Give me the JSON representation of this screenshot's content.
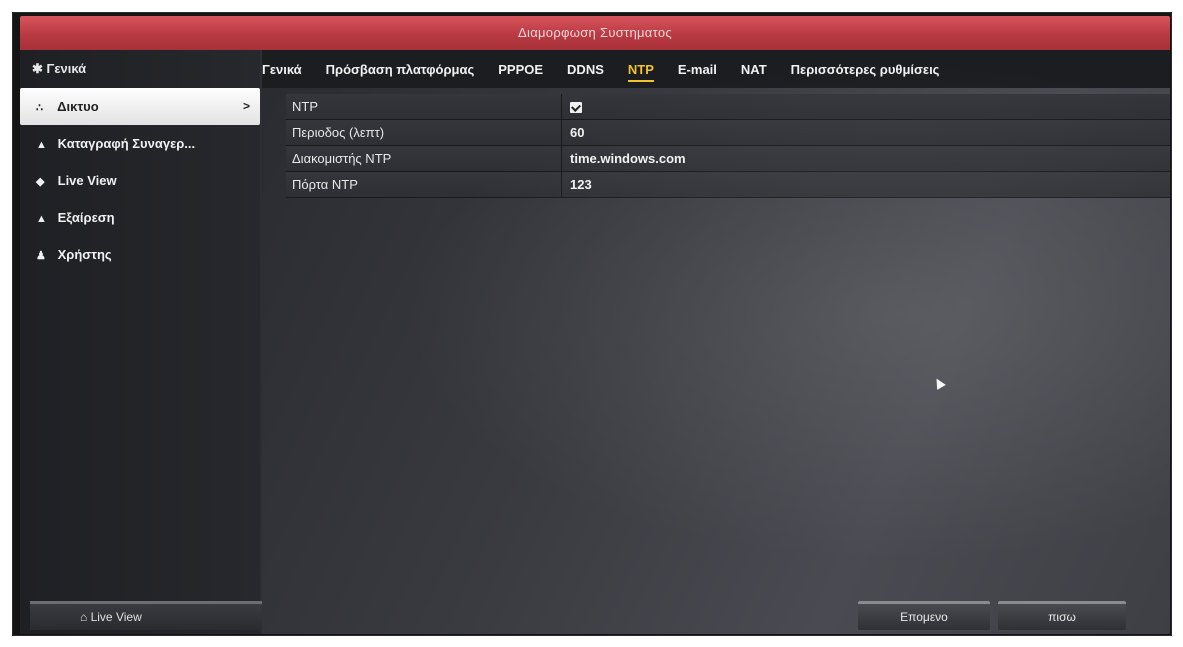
{
  "window": {
    "title": "Διαμορφωση Συστηματος"
  },
  "sidebar": {
    "header": {
      "icon": "gear-icon",
      "label": "Γενικά"
    },
    "items": [
      {
        "icon": "network-icon",
        "label": "Δικτυο",
        "active": true,
        "arrow": ">"
      },
      {
        "icon": "alarm-icon",
        "label": "Καταγραφή Συναγερ..."
      },
      {
        "icon": "eye-icon",
        "label": "Live View"
      },
      {
        "icon": "warning-icon",
        "label": "Εξαίρεση"
      },
      {
        "icon": "user-icon",
        "label": "Χρήστης"
      }
    ],
    "footer": {
      "icon": "home-icon",
      "label": "Live View"
    }
  },
  "tabs": [
    {
      "label": "Γενικά"
    },
    {
      "label": "Πρόσβαση πλατφόρμας"
    },
    {
      "label": "PPPOE"
    },
    {
      "label": "DDNS"
    },
    {
      "label": "NTP",
      "active": true
    },
    {
      "label": "E-mail"
    },
    {
      "label": "NAT"
    },
    {
      "label": "Περισσότερες ρυθμίσεις"
    }
  ],
  "ntp": {
    "rows": [
      {
        "label": "NTP",
        "checked": true
      },
      {
        "label": "Περιοδος (λεπτ)",
        "value": "60"
      },
      {
        "label": "Διακομιστής NTP",
        "value": "time.windows.com"
      },
      {
        "label": "Πόρτα NTP",
        "value": "123"
      }
    ]
  },
  "buttons": {
    "next": "Επομενο",
    "back": "πισω"
  },
  "colors": {
    "title_bar": "#b93a43",
    "active_tab": "#f2c230"
  }
}
